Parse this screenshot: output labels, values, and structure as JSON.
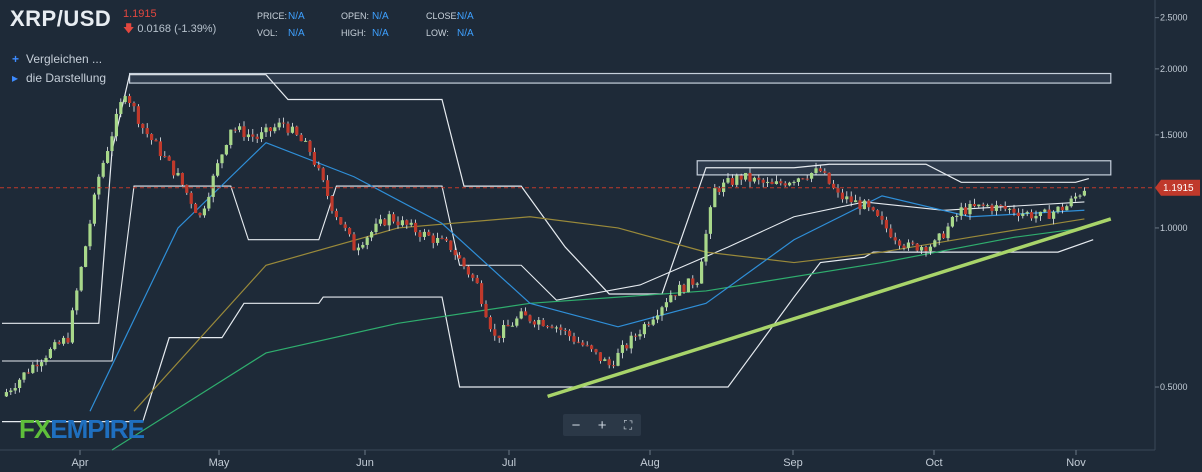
{
  "header": {
    "symbol": "XRP/USD",
    "last_price": "1.1915",
    "change_arrow": "🡇",
    "change": "0.0168 (-1.39%)",
    "ohlc": [
      {
        "label": "PRICE:",
        "value": "N/A"
      },
      {
        "label": "VOL:",
        "value": "N/A"
      },
      {
        "label": "OPEN:",
        "value": "N/A"
      },
      {
        "label": "HIGH:",
        "value": "N/A"
      },
      {
        "label": "CLOSE:",
        "value": "N/A"
      },
      {
        "label": "LOW:",
        "value": "N/A"
      }
    ]
  },
  "sidebar": {
    "compare_icon": "plus-icon",
    "compare_label": "Vergleichen ...",
    "display_icon": "play-icon",
    "display_label": "die Darstellung"
  },
  "zoom_controls": {
    "minus": "−",
    "plus": "+",
    "fullscreen": "⛶"
  },
  "logo": {
    "fx": "FX",
    "empire": "EMPIRE"
  },
  "colors": {
    "background": "#1e2a38",
    "up_candle": "#a8d88a",
    "down_candle": "#c0392b",
    "ma_fast": "#2f8fd8",
    "ma_mid": "#9a8a3a",
    "ma_slow": "#2fae6e",
    "trendline": "#a8d46a",
    "price_badge": "#c0392b",
    "price_line": "#c0392b"
  },
  "chart_data": {
    "type": "candlestick",
    "y_scale": "log",
    "ylim": [
      0.38,
      2.7
    ],
    "yticks": [
      "2.5000",
      "2.0000",
      "1.5000",
      "1.0000",
      "0.5000"
    ],
    "ytick_values": [
      2.5,
      2.0,
      1.5,
      1.0,
      0.5
    ],
    "xticks": [
      "Apr",
      "May",
      "Jun",
      "Jul",
      "Aug",
      "Sep",
      "Oct",
      "Nov"
    ],
    "current_price_label": "1.1915",
    "current_price": 1.1915,
    "anchors": [
      [
        0,
        0.48
      ],
      [
        8,
        0.56
      ],
      [
        15,
        0.62
      ],
      [
        22,
        1.25
      ],
      [
        28,
        1.82
      ],
      [
        32,
        1.55
      ],
      [
        40,
        1.25
      ],
      [
        45,
        1.05
      ],
      [
        52,
        1.55
      ],
      [
        58,
        1.48
      ],
      [
        64,
        1.58
      ],
      [
        70,
        1.4
      ],
      [
        75,
        1.1
      ],
      [
        80,
        0.92
      ],
      [
        88,
        1.05
      ],
      [
        95,
        0.98
      ],
      [
        102,
        0.92
      ],
      [
        108,
        0.78
      ],
      [
        112,
        0.62
      ],
      [
        118,
        0.68
      ],
      [
        125,
        0.66
      ],
      [
        132,
        0.6
      ],
      [
        138,
        0.55
      ],
      [
        145,
        0.64
      ],
      [
        152,
        0.75
      ],
      [
        158,
        0.8
      ],
      [
        162,
        1.18
      ],
      [
        168,
        1.25
      ],
      [
        175,
        1.2
      ],
      [
        182,
        1.26
      ],
      [
        186,
        1.28
      ],
      [
        190,
        1.15
      ],
      [
        196,
        1.1
      ],
      [
        202,
        0.98
      ],
      [
        206,
        0.92
      ],
      [
        212,
        0.93
      ],
      [
        218,
        1.08
      ],
      [
        224,
        1.1
      ],
      [
        230,
        1.08
      ],
      [
        236,
        1.05
      ],
      [
        242,
        1.1
      ],
      [
        246,
        1.19
      ]
    ],
    "ma_fast": [
      [
        20,
        0.45
      ],
      [
        40,
        1.0
      ],
      [
        60,
        1.45
      ],
      [
        80,
        1.25
      ],
      [
        100,
        1.02
      ],
      [
        120,
        0.72
      ],
      [
        140,
        0.65
      ],
      [
        160,
        0.72
      ],
      [
        180,
        0.95
      ],
      [
        200,
        1.15
      ],
      [
        220,
        1.05
      ],
      [
        246,
        1.08
      ]
    ],
    "ma_mid": [
      [
        30,
        0.45
      ],
      [
        60,
        0.85
      ],
      [
        90,
        1.0
      ],
      [
        120,
        1.05
      ],
      [
        140,
        1.0
      ],
      [
        160,
        0.9
      ],
      [
        180,
        0.86
      ],
      [
        200,
        0.9
      ],
      [
        220,
        0.96
      ],
      [
        246,
        1.04
      ]
    ],
    "ma_slow": [
      [
        25,
        0.38
      ],
      [
        60,
        0.58
      ],
      [
        90,
        0.66
      ],
      [
        120,
        0.72
      ],
      [
        160,
        0.76
      ],
      [
        200,
        0.86
      ],
      [
        230,
        0.96
      ],
      [
        246,
        1.0
      ]
    ],
    "trendline": [
      [
        124,
        0.48
      ],
      [
        252,
        1.04
      ]
    ],
    "zones": [
      {
        "from": 29,
        "to": 252,
        "low": 1.88,
        "high": 1.96
      },
      {
        "from": 158,
        "to": 252,
        "low": 1.26,
        "high": 1.34
      }
    ],
    "bands": {
      "upper": [
        [
          0,
          0.66
        ],
        [
          22,
          0.66
        ],
        [
          25,
          1.4
        ],
        [
          29,
          1.95
        ],
        [
          60,
          1.95
        ],
        [
          65,
          1.75
        ],
        [
          100,
          1.75
        ],
        [
          105,
          1.2
        ],
        [
          118,
          1.2
        ],
        [
          128,
          0.92
        ],
        [
          138,
          0.75
        ],
        [
          150,
          0.75
        ],
        [
          160,
          1.3
        ],
        [
          180,
          1.3
        ],
        [
          188,
          1.32
        ],
        [
          210,
          1.32
        ],
        [
          218,
          1.22
        ],
        [
          244,
          1.22
        ],
        [
          247,
          1.24
        ]
      ],
      "lower": [
        [
          0,
          0.43
        ],
        [
          25,
          0.43
        ],
        [
          32,
          0.43
        ],
        [
          38,
          0.62
        ],
        [
          50,
          0.62
        ],
        [
          55,
          0.72
        ],
        [
          72,
          0.72
        ],
        [
          73,
          0.74
        ],
        [
          100,
          0.74
        ],
        [
          104,
          0.5
        ],
        [
          165,
          0.5
        ],
        [
          172,
          0.6
        ],
        [
          180,
          0.74
        ],
        [
          186,
          0.86
        ],
        [
          196,
          0.88
        ],
        [
          198,
          0.9
        ],
        [
          240,
          0.9
        ],
        [
          248,
          0.95
        ]
      ],
      "middle": [
        [
          0,
          0.56
        ],
        [
          25,
          0.56
        ],
        [
          30,
          1.2
        ],
        [
          52,
          1.2
        ],
        [
          56,
          0.95
        ],
        [
          72,
          0.95
        ],
        [
          76,
          1.2
        ],
        [
          100,
          1.2
        ],
        [
          104,
          0.85
        ],
        [
          118,
          0.85
        ],
        [
          126,
          0.73
        ],
        [
          145,
          0.78
        ],
        [
          165,
          0.92
        ],
        [
          180,
          1.05
        ],
        [
          196,
          1.12
        ],
        [
          214,
          1.08
        ],
        [
          246,
          1.12
        ]
      ]
    }
  }
}
